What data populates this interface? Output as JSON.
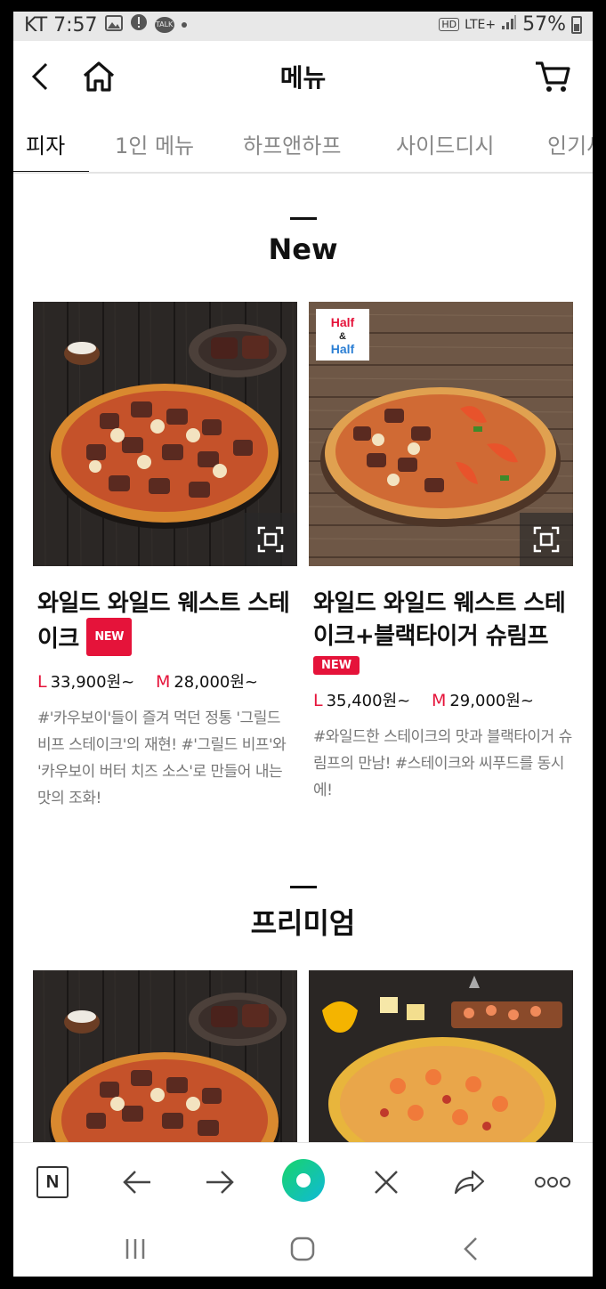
{
  "status_bar": {
    "carrier_time": "KT 7:57",
    "network": "LTE+",
    "battery": "57%",
    "kakaotalk_label": "TALK"
  },
  "header": {
    "title": "메뉴",
    "back_icon": "chevron-left-icon",
    "home_icon": "home-icon",
    "cart_icon": "cart-icon"
  },
  "tabs": [
    {
      "label": "피자",
      "active": true
    },
    {
      "label": "1인 메뉴",
      "active": false
    },
    {
      "label": "하프앤하프",
      "active": false
    },
    {
      "label": "사이드디시",
      "active": false
    },
    {
      "label": "인기세",
      "active": false
    }
  ],
  "sections": [
    {
      "title": "New",
      "items": [
        {
          "name": "와일드 와일드 웨스트 스테이크",
          "badge": "NEW",
          "price_l_size": "L",
          "price_l": "33,900원~",
          "price_m_size": "M",
          "price_m": "28,000원~",
          "description": "#'카우보이'들이 즐겨 먹던 정통 '그릴드 비프 스테이크'의 재현! #'그릴드 비프'와 '카우보이 버터 치즈 소스'로 만들어 내는 맛의 조화!"
        },
        {
          "name": "와일드 와일드 웨스트 스테이크+블랙타이거 슈림프",
          "badge": "NEW",
          "half_label_1": "Half",
          "half_amp": "&",
          "half_label_2": "Half",
          "price_l_size": "L",
          "price_l": "35,400원~",
          "price_m_size": "M",
          "price_m": "29,000원~",
          "description": "#와일드한 스테이크의 맛과 블랙타이거 슈림프의 만남! #스테이크와 씨푸드를 동시에!"
        }
      ]
    },
    {
      "title": "프리미엄",
      "items": []
    }
  ],
  "toolbar": {
    "naver_label": "N",
    "icons": [
      "naver-icon",
      "back-arrow-icon",
      "forward-arrow-icon",
      "green-dot-icon",
      "close-icon",
      "share-icon",
      "more-icon"
    ]
  },
  "colors": {
    "accent_red": "#e5133a",
    "naver_green": "#19d4a6"
  }
}
